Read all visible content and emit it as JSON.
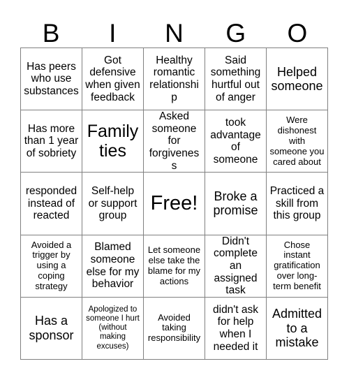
{
  "card": {
    "title_letters": [
      "B",
      "I",
      "N",
      "G",
      "O"
    ],
    "grid_size": 5,
    "free_space_label": "Free!",
    "free_space_position": {
      "row": 3,
      "col": 3
    },
    "border_color": "#808080",
    "text_color": "#000000",
    "background_color": "#ffffff",
    "rows": [
      [
        {
          "text": "Has peers who use substances",
          "size": "fs-md"
        },
        {
          "text": "Got defensive when given feedback",
          "size": "fs-md"
        },
        {
          "text": "Healthy romantic relationship",
          "size": "fs-md"
        },
        {
          "text": "Said something hurtful out of anger",
          "size": "fs-md"
        },
        {
          "text": "Helped someone",
          "size": "fs-lg"
        }
      ],
      [
        {
          "text": "Has more than 1 year of sobriety",
          "size": "fs-md"
        },
        {
          "text": "Family ties",
          "size": "fs-xl"
        },
        {
          "text": "Asked someone for forgiveness",
          "size": "fs-md"
        },
        {
          "text": "took advantage of someone",
          "size": "fs-md"
        },
        {
          "text": "Were dishonest with someone you cared about",
          "size": "fs-sm"
        }
      ],
      [
        {
          "text": "responded instead of reacted",
          "size": "fs-md"
        },
        {
          "text": "Self-help or support group",
          "size": "fs-md"
        },
        {
          "text": "Free!",
          "size": "free"
        },
        {
          "text": "Broke a promise",
          "size": "fs-lg"
        },
        {
          "text": "Practiced a skill from this group",
          "size": "fs-md"
        }
      ],
      [
        {
          "text": "Avoided a trigger by using a coping strategy",
          "size": "fs-sm"
        },
        {
          "text": "Blamed someone else for my behavior",
          "size": "fs-md"
        },
        {
          "text": "Let someone else take the blame for my actions",
          "size": "fs-sm"
        },
        {
          "text": "Didn't complete an assigned task",
          "size": "fs-md"
        },
        {
          "text": "Chose instant gratification over long-term benefit",
          "size": "fs-sm"
        }
      ],
      [
        {
          "text": "Has a sponsor",
          "size": "fs-lg"
        },
        {
          "text": "Apologized to someone I hurt (without making excuses)",
          "size": "fs-xs"
        },
        {
          "text": "Avoided taking responsibility",
          "size": "fs-sm"
        },
        {
          "text": "didn't ask for help when I needed it",
          "size": "fs-md"
        },
        {
          "text": "Admitted to a mistake",
          "size": "fs-lg"
        }
      ]
    ]
  }
}
